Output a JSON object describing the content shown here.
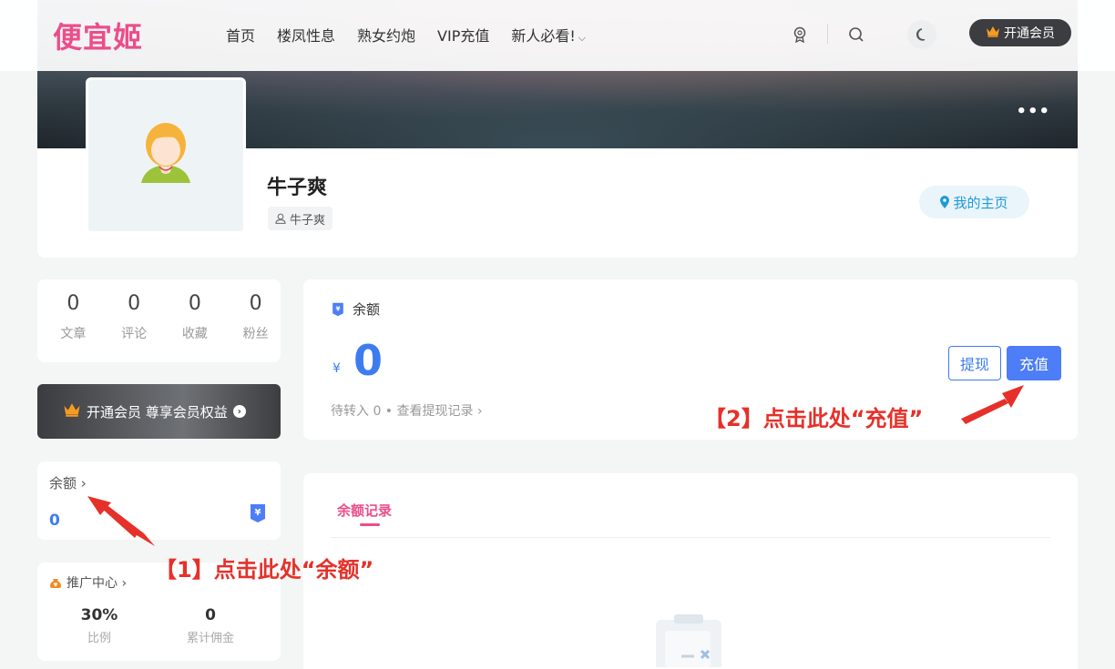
{
  "header": {
    "logo": "便宜姬",
    "nav": [
      "首页",
      "楼凤性息",
      "熟女约炮",
      "VIP充值",
      "新人必看!"
    ],
    "vip_button": "开通会员"
  },
  "profile": {
    "name": "牛子爽",
    "handle": "牛子爽",
    "home_button": "我的主页"
  },
  "stats": [
    {
      "value": "0",
      "label": "文章"
    },
    {
      "value": "0",
      "label": "评论"
    },
    {
      "value": "0",
      "label": "收藏"
    },
    {
      "value": "0",
      "label": "粉丝"
    }
  ],
  "vip_bar": {
    "label": "开通会员 尊享会员权益"
  },
  "balance_mini": {
    "title": "余额 ›",
    "value": "0"
  },
  "promo": {
    "title": "推广中心 ›",
    "rate": "30%",
    "rate_label": "比例",
    "commission": "0",
    "commission_label": "累计佣金"
  },
  "balance": {
    "title": "余额",
    "currency": "¥",
    "amount": "0",
    "sub": "待转入 0 • 查看提现记录 ›",
    "withdraw": "提现",
    "recharge": "充值"
  },
  "records": {
    "tab": "余额记录"
  },
  "annotations": {
    "step1": "【1】点击此处“余额”",
    "step2": "【2】点击此处“充值”"
  },
  "colors": {
    "accent_pink": "#ec4d8a",
    "accent_blue": "#3d7cf0",
    "annotation_red": "#e5312a"
  }
}
